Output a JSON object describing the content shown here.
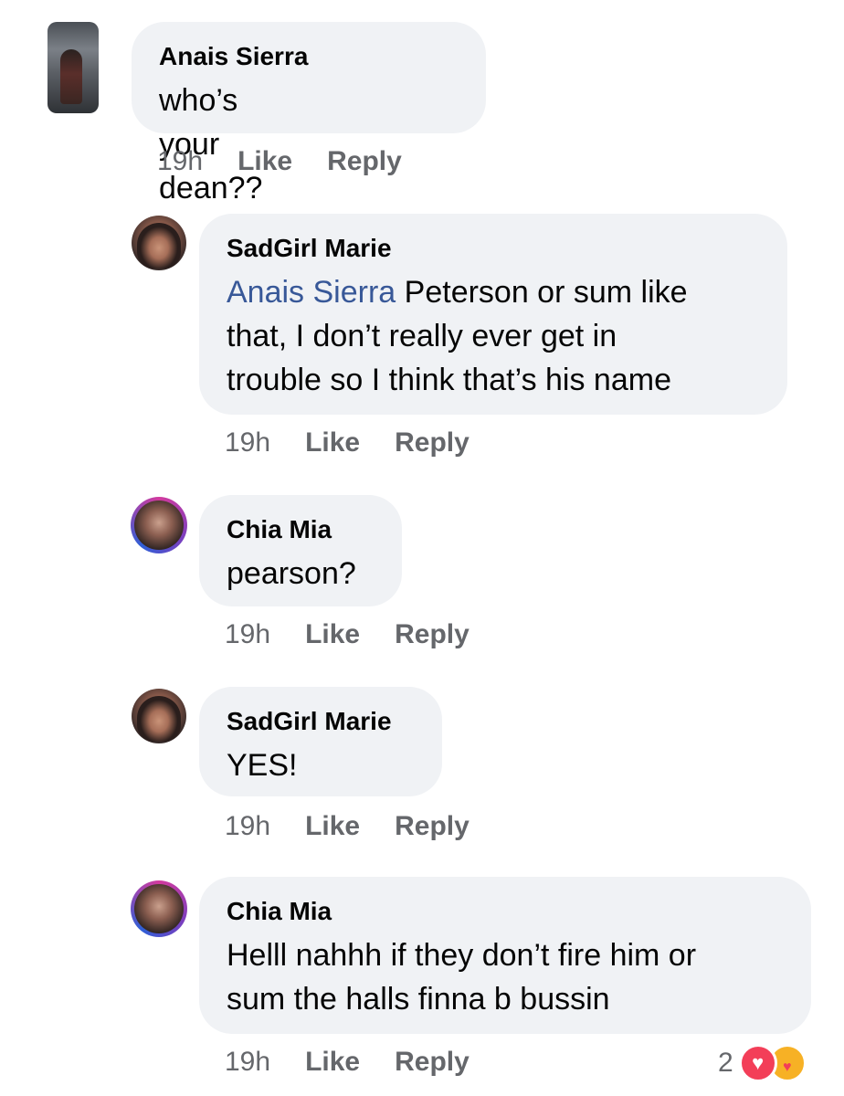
{
  "comments": [
    {
      "author": "Anais Sierra",
      "text": "who’s your dean??",
      "time": "19h",
      "like_label": "Like",
      "reply_label": "Reply"
    },
    {
      "author": "SadGirl Marie",
      "mention": "Anais Sierra",
      "text_line1": "Peterson or sum like",
      "text_line2": "that, I don’t really  ever get in",
      "text_line3": "trouble so I think that’s his name",
      "time": "19h",
      "like_label": "Like",
      "reply_label": "Reply"
    },
    {
      "author": "Chia Mia",
      "text": "pearson?",
      "time": "19h",
      "like_label": "Like",
      "reply_label": "Reply"
    },
    {
      "author": "SadGirl Marie",
      "text": "YES!",
      "time": "19h",
      "like_label": "Like",
      "reply_label": "Reply"
    },
    {
      "author": "Chia Mia",
      "text_line1": "Helll nahhh if they don’t fire him or",
      "text_line2": "sum the halls finna b bussin",
      "time": "19h",
      "like_label": "Like",
      "reply_label": "Reply",
      "reaction_count": "2",
      "reaction_icons": [
        "love-icon",
        "care-icon"
      ]
    }
  ],
  "colors": {
    "bubble": "#f0f2f5",
    "mention": "#385898",
    "meta": "#65676b",
    "love": "#f33e58",
    "care": "#f7b125"
  }
}
